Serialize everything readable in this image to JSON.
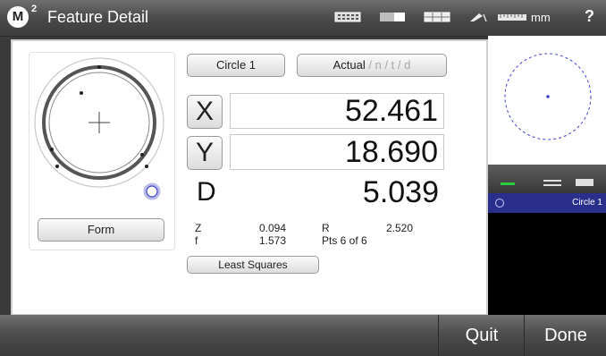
{
  "titlebar": {
    "logo": "M",
    "logo_sup": "2",
    "title": "Feature Detail",
    "units": "mm",
    "help": "?",
    "icons": [
      "keypad-icon",
      "display-icon",
      "grid-icon",
      "probe-icon",
      "ruler-icon"
    ]
  },
  "gauge": {
    "form_button": "Form"
  },
  "feature": {
    "name": "Circle 1",
    "actual_mode": "Actual",
    "actual_options": " / n / t / d"
  },
  "measurements": {
    "x_label": "X",
    "x_value": "52.461",
    "y_label": "Y",
    "y_value": "18.690",
    "d_label": "D",
    "d_value": "5.039",
    "z_label": "Z",
    "z_value": "0.094",
    "r_label": "R",
    "r_value": "2.520",
    "f_label": "f",
    "f_value": "1.573",
    "pts": "Pts 6 of 6"
  },
  "fit_button": "Least Squares",
  "feature_list": {
    "items": [
      {
        "name": "Circle 1",
        "selected": true
      }
    ]
  },
  "bottombar": {
    "quit": "Quit",
    "done": "Done"
  },
  "colors": {
    "selection": "#2b2f8c",
    "accent_green": "#2ecc40",
    "preview_circle": "#3b40c9"
  }
}
